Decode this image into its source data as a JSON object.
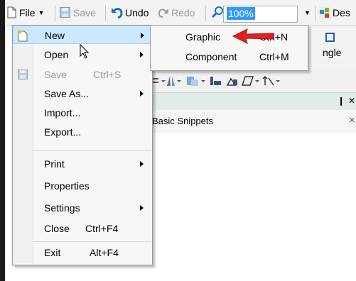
{
  "toolbar": {
    "file_label": "File",
    "save_label": "Save",
    "undo_label": "Undo",
    "redo_label": "Redo",
    "zoom_value": "100%",
    "design_label": "Des"
  },
  "file_menu": {
    "items": [
      {
        "label": "New",
        "shortcut": "",
        "submenu": true
      },
      {
        "label": "Open",
        "shortcut": "",
        "submenu": true
      },
      {
        "label": "Save",
        "shortcut": "Ctrl+S",
        "submenu": false
      },
      {
        "label": "Save As...",
        "shortcut": "",
        "submenu": true
      },
      {
        "label": "Import...",
        "shortcut": "",
        "submenu": false
      },
      {
        "label": "Export...",
        "shortcut": "",
        "submenu": false
      },
      {
        "label": "Print",
        "shortcut": "",
        "submenu": true
      },
      {
        "label": "Properties",
        "shortcut": "",
        "submenu": false
      },
      {
        "label": "Settings",
        "shortcut": "",
        "submenu": true
      },
      {
        "label": "Close",
        "shortcut": "Ctrl+F4",
        "submenu": false
      },
      {
        "label": "Exit",
        "shortcut": "Alt+F4",
        "submenu": false
      }
    ]
  },
  "new_submenu": {
    "items": [
      {
        "label": "Graphic",
        "shortcut": "Ctrl+N"
      },
      {
        "label": "Component",
        "shortcut": "Ctrl+M"
      }
    ]
  },
  "ribbon": {
    "partial_label": "ngle"
  },
  "snippets": {
    "pin_glyph": "❙",
    "close_glyph": "✕",
    "tab_label": "Basic Snippets",
    "tab_close": "×"
  },
  "colors": {
    "highlight": "#cce8ff",
    "highlight_border": "#99d1ff",
    "arrow_red": "#e02020",
    "selection_blue": "#3399ff",
    "undo_blue": "#1e6fd0",
    "panel_green": "#e1ece8"
  }
}
